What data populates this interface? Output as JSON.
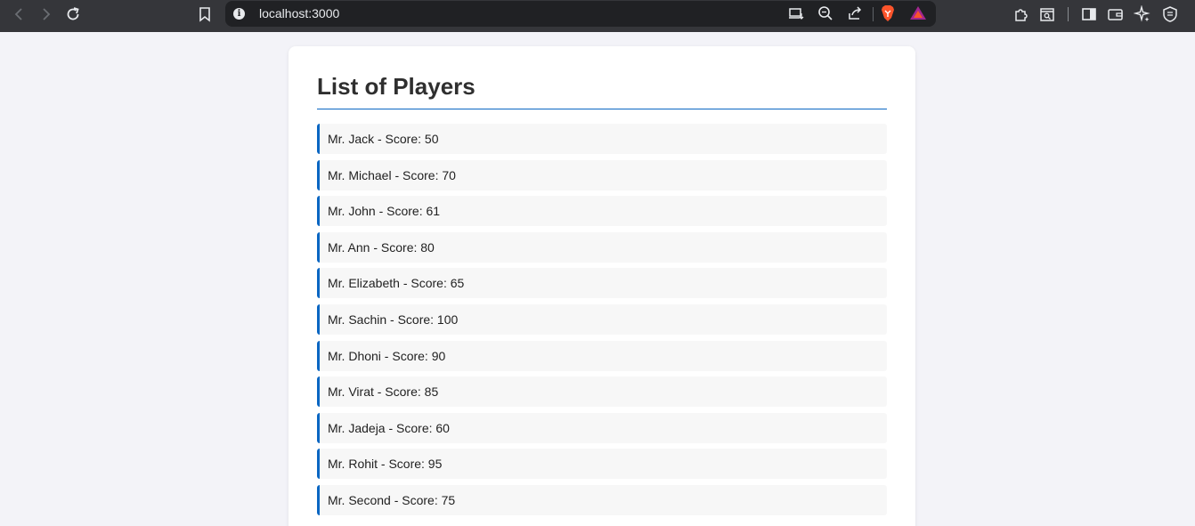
{
  "browser": {
    "url": "localhost:3000",
    "icons": [
      "back-icon",
      "forward-icon",
      "reload-icon",
      "bookmark-icon",
      "site-info-icon",
      "install-app-icon",
      "zoom-icon",
      "share-icon",
      "brave-shields-icon",
      "brave-rewards-icon",
      "extensions-icon",
      "tab-search-icon",
      "sidebar-icon",
      "wallet-icon",
      "leo-ai-icon",
      "vpn-icon"
    ],
    "accent": "#fb542b"
  },
  "page": {
    "title": "List of Players",
    "accent": "#0a66c2",
    "players": [
      {
        "label": "Mr. Jack - Score: 50"
      },
      {
        "label": "Mr. Michael - Score: 70"
      },
      {
        "label": "Mr. John - Score: 61"
      },
      {
        "label": "Mr. Ann - Score: 80"
      },
      {
        "label": "Mr. Elizabeth - Score: 65"
      },
      {
        "label": "Mr. Sachin - Score: 100"
      },
      {
        "label": "Mr. Dhoni - Score: 90"
      },
      {
        "label": "Mr. Virat - Score: 85"
      },
      {
        "label": "Mr. Jadeja - Score: 60"
      },
      {
        "label": "Mr. Rohit - Score: 95"
      },
      {
        "label": "Mr. Second - Score: 75"
      }
    ]
  }
}
